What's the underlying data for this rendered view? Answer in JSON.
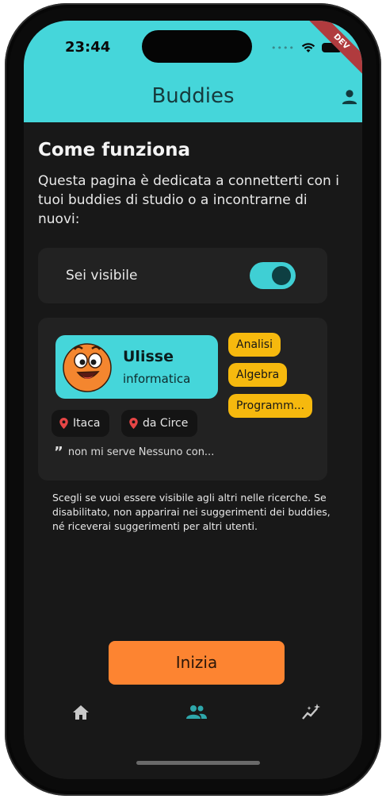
{
  "status": {
    "time": "23:44",
    "dev_badge": "DEV"
  },
  "appbar": {
    "title": "Buddies",
    "profile_icon": "person-icon",
    "color": "#45d6da"
  },
  "intro": {
    "heading": "Come funziona",
    "text": "Questa pagina è dedicata a connetterti con i tuoi buddies di studio o a incontrarne di nuovi:"
  },
  "visibility": {
    "label": "Sei visibile",
    "enabled": true
  },
  "preview": {
    "name": "Ulisse",
    "course": "informatica",
    "tags": [
      "Analisi",
      "Algebra",
      "Programm..."
    ],
    "location": "Itaca",
    "origin": "da Circe",
    "quote": "non mi serve Nessuno con..."
  },
  "hint": "Scegli se vuoi essere visibile agli altri nelle ricerche. Se disabilitato, non apparirai nei suggerimenti dei buddies, né riceverai suggerimenti per altri utenti.",
  "actions": {
    "start_label": "Inizia",
    "start_color": "#fd8431"
  },
  "bottom_nav": [
    {
      "icon": "home-icon",
      "active": false
    },
    {
      "icon": "people-icon",
      "active": true
    },
    {
      "icon": "sparkle-chart-icon",
      "active": false
    }
  ]
}
